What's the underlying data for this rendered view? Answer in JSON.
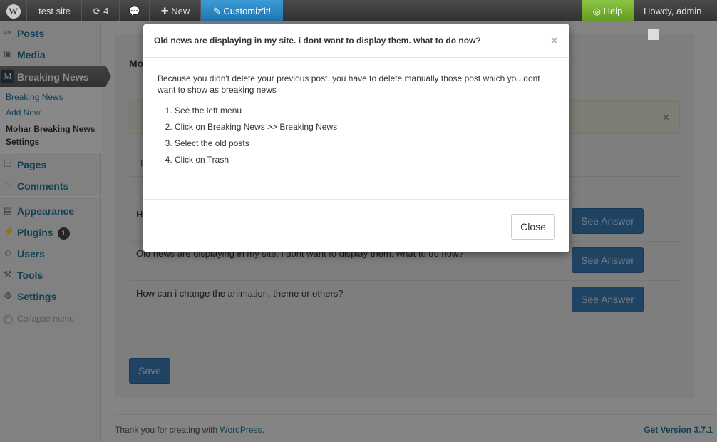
{
  "adminbar": {
    "site": "test site",
    "updates": "4",
    "new": "New",
    "customize": "Customiz'it!",
    "help": "Help",
    "howdy": "Howdy, admin"
  },
  "sidebar": {
    "items": [
      {
        "label": "Posts",
        "icon": "pin-icon"
      },
      {
        "label": "Media",
        "icon": "media-icon"
      },
      {
        "label": "Breaking News",
        "icon": "plugin-logo-icon"
      },
      {
        "label": "Pages",
        "icon": "pages-icon"
      },
      {
        "label": "Comments",
        "icon": "comments-icon"
      },
      {
        "label": "Appearance",
        "icon": "appearance-icon"
      },
      {
        "label": "Plugins",
        "icon": "plugins-icon",
        "badge": "1"
      },
      {
        "label": "Users",
        "icon": "users-icon"
      },
      {
        "label": "Tools",
        "icon": "tools-icon"
      },
      {
        "label": "Settings",
        "icon": "settings-icon"
      }
    ],
    "submenu": [
      "Breaking News",
      "Add New",
      "Mohar Breaking News Settings"
    ],
    "collapse": "Collapse menu"
  },
  "main": {
    "title_fragment": "Mo",
    "tab_fragment": "D",
    "questions": [
      {
        "text": "H",
        "button": "See Answer"
      },
      {
        "text": "Old news are displaying in my site. i dont want to display them. what to do now?",
        "button": "See Answer"
      },
      {
        "text": "How can i change the animation, theme or others?",
        "button": "See Answer"
      }
    ],
    "save": "Save"
  },
  "footer": {
    "thanks": "Thank you for creating with ",
    "wordpress": "WordPress",
    "period": ".",
    "version": "Get Version 3.7.1"
  },
  "modal": {
    "title": "Old news are displaying in my site. i dont want to display them. what to do now?",
    "close_x": "×",
    "intro": "Because you didn't delete your previous post. you have to delete manually those post which you dont want to show as breaking news",
    "steps": [
      "See the left menu",
      "Click on Breaking News >> Breaking News",
      "Select the old posts",
      "Click on Trash"
    ],
    "close_button": "Close"
  }
}
